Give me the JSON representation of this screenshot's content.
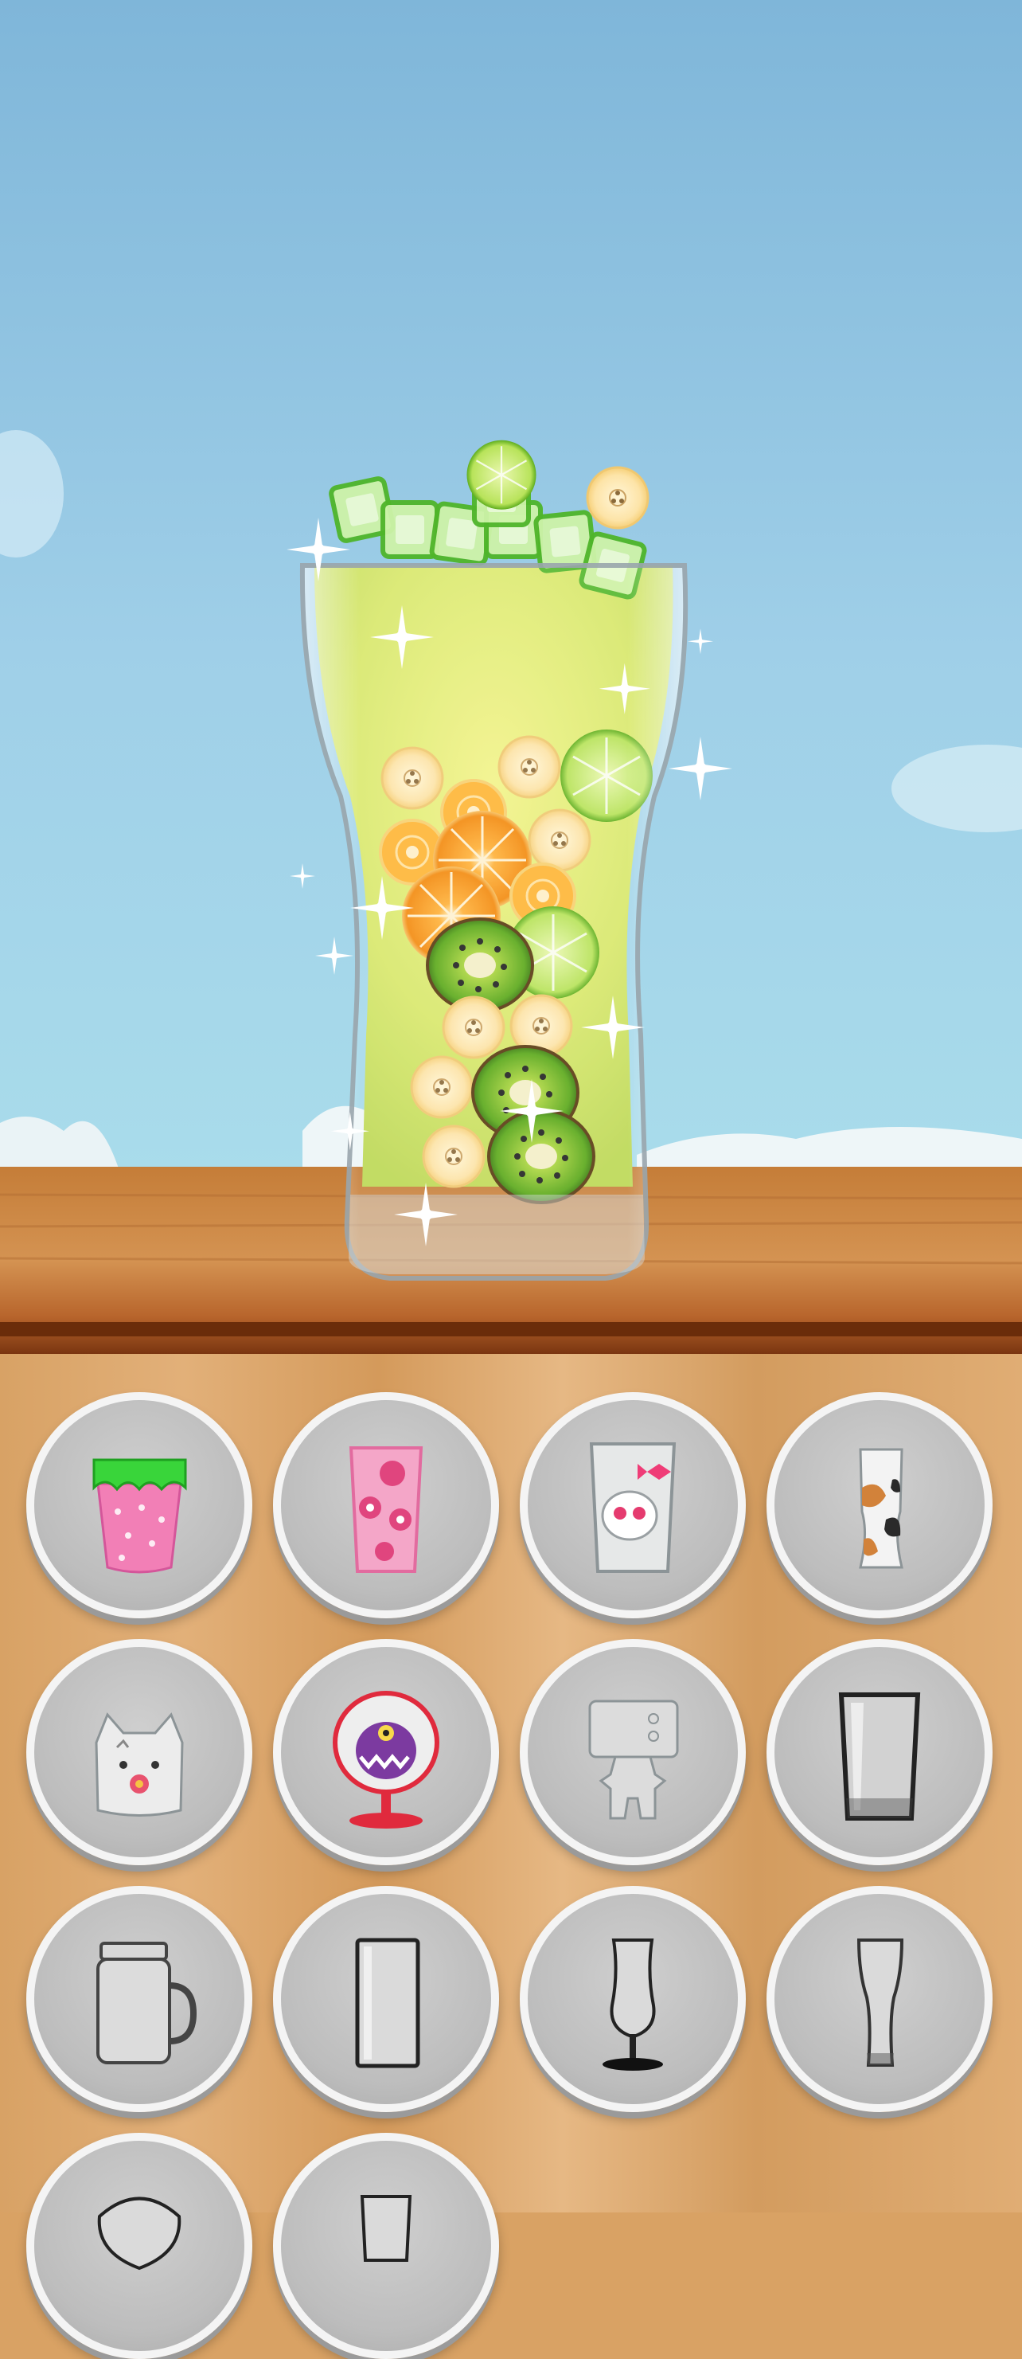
{
  "game": {
    "scene": "drink-glass-preview",
    "drink": {
      "liquid_color": "#dbe86e",
      "toppings": [
        "ice-cube-icon",
        "lime-slice-icon",
        "banana-slice-icon",
        "orange-slice-icon",
        "kiwi-slice-icon",
        "sparkle-icon"
      ]
    },
    "cup_options": [
      {
        "icon": "strawberry-cup-icon"
      },
      {
        "icon": "pink-bear-cup-icon"
      },
      {
        "icon": "bow-skull-cup-icon"
      },
      {
        "icon": "cow-print-cup-icon"
      },
      {
        "icon": "cat-face-cup-icon"
      },
      {
        "icon": "monster-goblet-icon"
      },
      {
        "icon": "robot-cup-icon"
      },
      {
        "icon": "tumbler-glass-icon"
      },
      {
        "icon": "mason-jar-mug-icon"
      },
      {
        "icon": "tall-glass-icon"
      },
      {
        "icon": "hurricane-glass-icon"
      },
      {
        "icon": "pilsner-glass-icon"
      },
      {
        "icon": "bowl-glass-icon"
      },
      {
        "icon": "short-glass-icon"
      }
    ]
  }
}
